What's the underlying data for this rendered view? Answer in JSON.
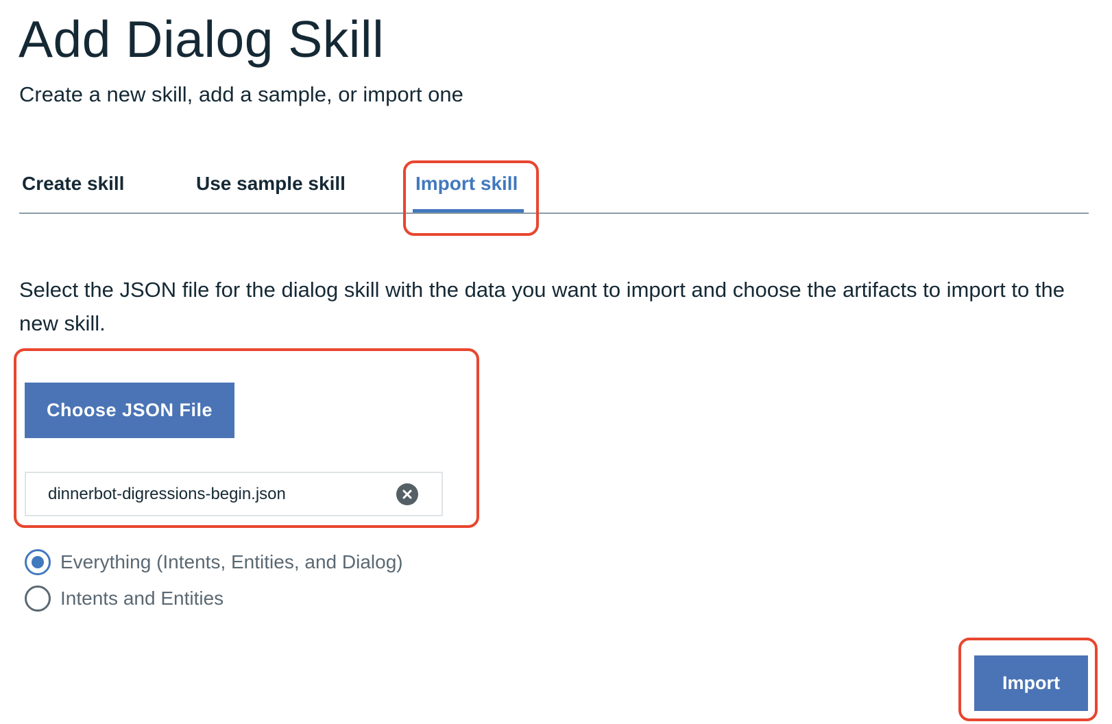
{
  "header": {
    "title": "Add Dialog Skill",
    "subtitle": "Create a new skill, add a sample, or import one"
  },
  "tabs": [
    {
      "label": "Create skill",
      "active": false
    },
    {
      "label": "Use sample skill",
      "active": false
    },
    {
      "label": "Import skill",
      "active": true
    }
  ],
  "import": {
    "description": "Select the JSON file for the dialog skill with the data you want to import and choose the artifacts to import to the new skill.",
    "choose_button_label": "Choose JSON File",
    "file_name": "dinnerbot-digressions-begin.json",
    "options": [
      {
        "label": "Everything (Intents, Entities, and Dialog)",
        "selected": true
      },
      {
        "label": "Intents and Entities",
        "selected": false
      }
    ],
    "submit_label": "Import"
  },
  "colors": {
    "accent": "#4178be",
    "button_bg": "#4a74b5",
    "highlight": "#e8462f",
    "text": "#152935",
    "muted_text": "#5a6872"
  },
  "icons": {
    "clear": "close-circle-icon"
  }
}
